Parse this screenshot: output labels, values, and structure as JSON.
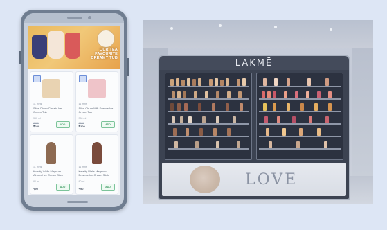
{
  "phone": {
    "banner": {
      "headline": "Our Tea Favourite Creamy Tub"
    },
    "products": [
      {
        "delivery": "11 mins",
        "name": "Slice Churn Classic Ice Cream Tub",
        "qty": "350 ml",
        "mrp": "₹285",
        "price": "₹200",
        "add_label": "ADD",
        "img_color": "#e9d3b2"
      },
      {
        "delivery": "11 mins",
        "name": "Slice Churn Milk Scence Ice Cream Tub",
        "qty": "350 ml",
        "mrp": "₹285",
        "price": "₹200",
        "add_label": "ADD",
        "img_color": "#efc4c9"
      },
      {
        "delivery": "11 mins",
        "name": "Kwality Walls Magnum Almond Ice Cream Stick",
        "qty": "80 ml",
        "mrp": "",
        "price": "₹90",
        "add_label": "ADD",
        "img_color": "#8d6a52"
      },
      {
        "delivery": "11 mins",
        "name": "Kwality Walls Magnum Brownie Ice Cream Stick",
        "qty": "80 ml",
        "mrp": "",
        "price": "₹90",
        "add_label": "ADD",
        "img_color": "#7a4b3c"
      }
    ]
  },
  "store": {
    "brand": "LAKMĒ",
    "poster_text": "LOVE"
  },
  "colors": {
    "background": "#dde6f5",
    "add_button": "#3f9a64",
    "banner": "#e9b95c"
  }
}
